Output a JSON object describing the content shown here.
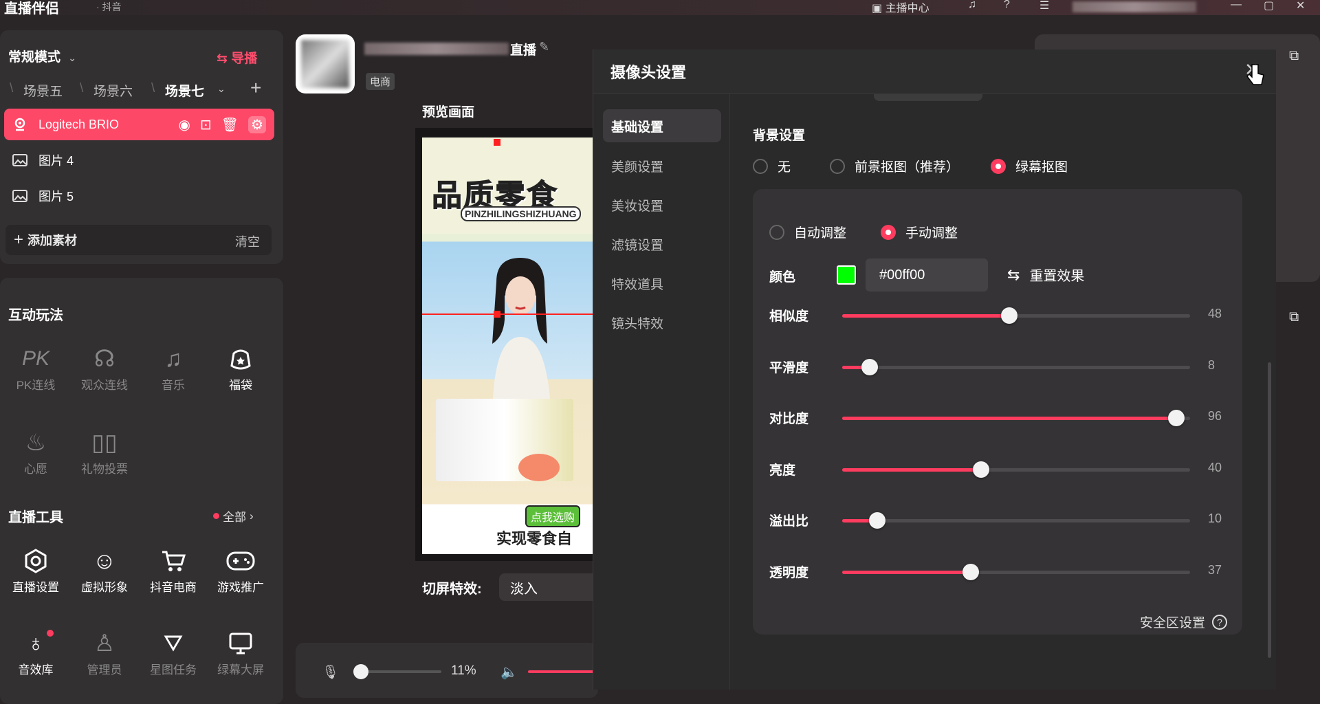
{
  "topbar": {
    "app_title": "直播伴侣",
    "app_sub": "· 抖音",
    "anchor_center": "主播中心"
  },
  "left": {
    "mode": "常规模式",
    "daobo": "导播",
    "scenes": [
      "场景五",
      "场景六",
      "场景七"
    ],
    "sources": [
      {
        "label": "Logitech BRIO",
        "active": true
      },
      {
        "label": "图片 4",
        "active": false
      },
      {
        "label": "图片 5",
        "active": false
      }
    ],
    "add_material": "添加素材",
    "clear": "清空",
    "interactive_title": "互动玩法",
    "interactive_tools": [
      {
        "label": "PK连线",
        "icon": "pk-icon"
      },
      {
        "label": "观众连线",
        "icon": "audience-link-icon"
      },
      {
        "label": "音乐",
        "icon": "music-icon"
      },
      {
        "label": "福袋",
        "icon": "lucky-bag-icon"
      },
      {
        "label": "心愿",
        "icon": "wish-icon"
      },
      {
        "label": "礼物投票",
        "icon": "gift-vote-icon"
      }
    ],
    "live_tools_title": "直播工具",
    "all_link": "全部",
    "live_tools": [
      {
        "label": "直播设置",
        "icon": "live-settings-icon"
      },
      {
        "label": "虚拟形象",
        "icon": "avatar-icon"
      },
      {
        "label": "抖音电商",
        "icon": "cart-icon"
      },
      {
        "label": "游戏推广",
        "icon": "gamepad-icon"
      },
      {
        "label": "音效库",
        "icon": "sound-effects-icon"
      },
      {
        "label": "管理员",
        "icon": "admin-icon"
      },
      {
        "label": "星图任务",
        "icon": "star-task-icon"
      },
      {
        "label": "绿幕大屏",
        "icon": "green-screen-icon"
      }
    ]
  },
  "center": {
    "room_suffix": "直播",
    "tag": "电商",
    "preview_label": "预览画面",
    "preview_banner": "品质零食",
    "preview_pinyin": "PINZHILINGSHIZHUANG",
    "preview_bottom": "实现零食自",
    "preview_button": "点我选购",
    "switch_label": "切屏特效:",
    "switch_value": "淡入",
    "mic_percent": "11%"
  },
  "dialog": {
    "title": "摄像头设置",
    "nav": [
      "基础设置",
      "美颜设置",
      "美妆设置",
      "滤镜设置",
      "特效道具",
      "镜头特效"
    ],
    "bg_title": "背景设置",
    "bg_options": [
      {
        "label": "无",
        "selected": false
      },
      {
        "label": "前景抠图（推荐）",
        "selected": false
      },
      {
        "label": "绿幕抠图",
        "selected": true
      }
    ],
    "adjust_options": [
      {
        "label": "自动调整",
        "selected": false
      },
      {
        "label": "手动调整",
        "selected": true
      }
    ],
    "color_label": "颜色",
    "color_hex": "#00ff00",
    "reset_label": "重置效果",
    "sliders": [
      {
        "label": "相似度",
        "value": 48,
        "pct": 0.48
      },
      {
        "label": "平滑度",
        "value": 8,
        "pct": 0.08
      },
      {
        "label": "对比度",
        "value": 96,
        "pct": 0.96
      },
      {
        "label": "亮度",
        "value": 40,
        "pct": 0.4
      },
      {
        "label": "溢出比",
        "value": 10,
        "pct": 0.1
      },
      {
        "label": "透明度",
        "value": 37,
        "pct": 0.37
      }
    ],
    "safe_area": "安全区设置"
  }
}
